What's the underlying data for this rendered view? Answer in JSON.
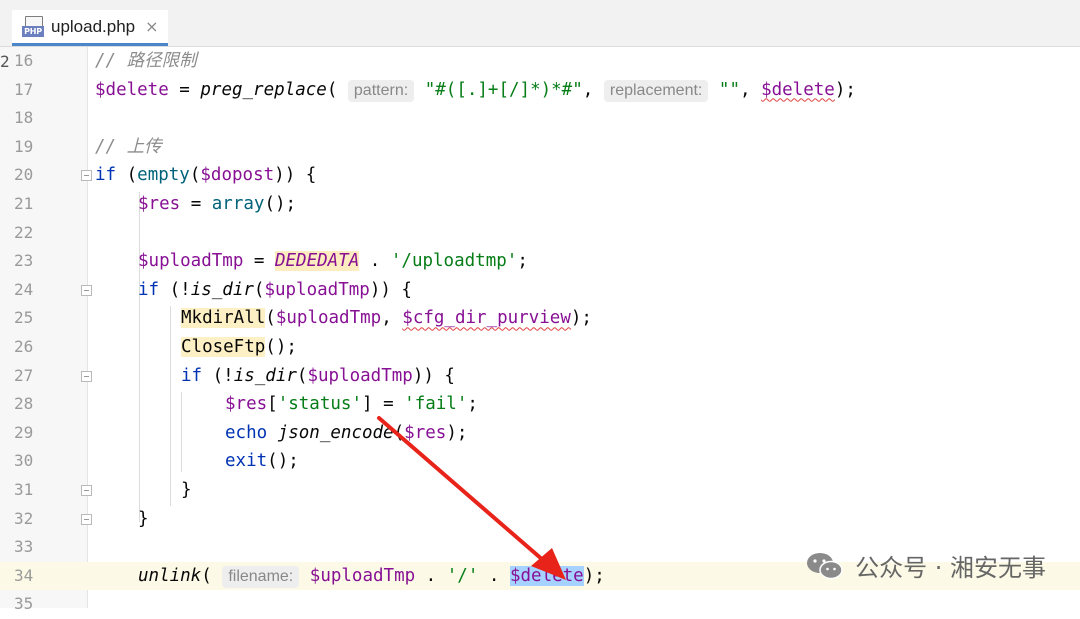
{
  "tab": {
    "icon": "php-file-icon",
    "title": "upload.php",
    "close": "×",
    "icon_text": "PHP"
  },
  "gutter_marker": "2",
  "lines": [
    {
      "num": "16",
      "c1": "// 路径限制"
    },
    {
      "num": "17",
      "var1": "$delete",
      "op1": " = ",
      "fn": "preg_replace",
      "p1": "(",
      "hint1": "pattern:",
      "str1": "\"#([.]+[/]*)*#\"",
      "comma": ",",
      "hint2": "replacement:",
      "str2": "\"\"",
      "comma2": ", ",
      "var2": "$delete",
      "end": ");"
    },
    {
      "num": "18"
    },
    {
      "num": "19",
      "c1": "// 上传"
    },
    {
      "num": "20",
      "kw": "if",
      "rest1": " (",
      "fn": "empty",
      "rest2": "(",
      "var": "$dopost",
      "rest3": ")) {"
    },
    {
      "num": "21",
      "var": "$res",
      "rest1": " = ",
      "fn": "array",
      "rest2": "();"
    },
    {
      "num": "22"
    },
    {
      "num": "23",
      "var": "$uploadTmp",
      "rest1": " = ",
      "const": "DEDEDATA",
      "rest2": " . ",
      "str": "'/uploadtmp'",
      "rest3": ";"
    },
    {
      "num": "24",
      "kw": "if",
      "rest1": " (!",
      "fn": "is_dir",
      "rest2": "(",
      "var": "$uploadTmp",
      "rest3": ")) {"
    },
    {
      "num": "25",
      "fn": "MkdirAll",
      "rest1": "(",
      "var1": "$uploadTmp",
      "rest2": ", ",
      "var2": "$cfg_dir_purview",
      "rest3": ");"
    },
    {
      "num": "26",
      "fn": "CloseFtp",
      "rest1": "();"
    },
    {
      "num": "27",
      "kw": "if",
      "rest1": " (!",
      "fn": "is_dir",
      "rest2": "(",
      "var": "$uploadTmp",
      "rest3": ")) {"
    },
    {
      "num": "28",
      "var": "$res",
      "rest1": "[",
      "str1": "'status'",
      "rest2": "] = ",
      "str2": "'fail'",
      "rest3": ";"
    },
    {
      "num": "29",
      "kw": "echo",
      "rest1": " ",
      "fn": "json_encode",
      "rest2": "(",
      "var": "$res",
      "rest3": ");"
    },
    {
      "num": "30",
      "kw": "exit",
      "rest1": "();"
    },
    {
      "num": "31",
      "rest1": "}"
    },
    {
      "num": "32",
      "rest1": "}"
    },
    {
      "num": "33"
    },
    {
      "num": "34",
      "fn": "unlink",
      "rest1": "(",
      "hint": "filename:",
      "var1": "$uploadTmp",
      "rest2": " . ",
      "str": "'/'",
      "rest3": " . ",
      "var2": "$delete",
      "rest4": ");"
    },
    {
      "num": "35"
    }
  ],
  "watermark": {
    "text": "公众号 · 湘安无事",
    "icon": "wechat-icon"
  },
  "colors": {
    "selection": "#a6d2ff",
    "arrow": "#e8231a",
    "tab_accent": "#4a86c8"
  }
}
